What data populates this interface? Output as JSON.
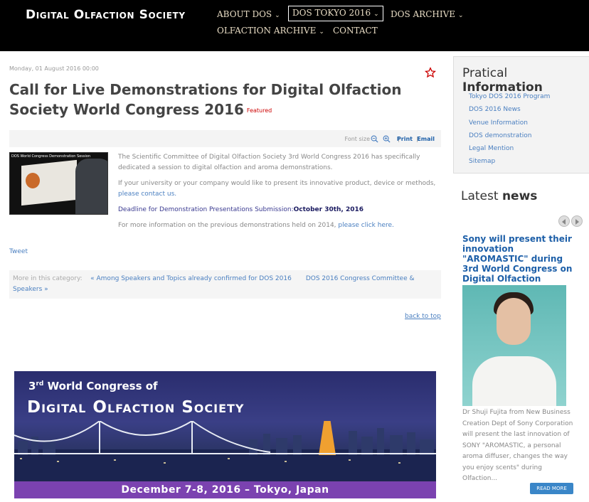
{
  "header": {
    "logo": "Digital Olfaction Society",
    "nav": [
      {
        "label": "ABOUT DOS",
        "has_dropdown": true
      },
      {
        "label": "DOS TOKYO 2016",
        "has_dropdown": true,
        "active": true
      },
      {
        "label": "DOS ARCHIVE",
        "has_dropdown": true
      },
      {
        "label": "OLFACTION ARCHIVE",
        "has_dropdown": true
      },
      {
        "label": "CONTACT",
        "has_dropdown": false
      }
    ]
  },
  "article": {
    "date": "Monday, 01 August 2016 00:00",
    "title": "Call for Live Demonstrations for Digital Olfaction Society World Congress 2016",
    "featured": "Featured",
    "toolbar": {
      "font_size": "Font size",
      "separator": "|",
      "print": "Print",
      "email": "Email"
    },
    "thumb_caption": "DOS World Congress Demonstration Session",
    "p1": "The Scientific Committee of Digital Olfaction Society 3rd World Congress 2016 has specifically dedicated a session to digital olfaction and aroma demonstrations.",
    "p2": "If your university or your company would like to present its innovative product, device or methods,",
    "p2_link": "please contact us.",
    "deadline_label": "Deadline for Demonstration Presentations Submission:",
    "deadline_date": "October 30th, 2016",
    "p4": "For more information on the previous demonstrations held on 2014,",
    "p4_link": "please click here.",
    "tweet": "Tweet",
    "more_label": "More in this category:",
    "prev_link": "« Among Speakers and Topics already confirmed for DOS 2016",
    "next_link": "DOS 2016 Congress Committee & Speakers »",
    "back_to_top": "back to top"
  },
  "banner": {
    "line1_ordinal": "3",
    "line1_sup": "rd",
    "line1_rest": "World Congress of",
    "line2": "Digital Olfaction Society",
    "bar": "December 7-8, 2016 – Tokyo, Japan"
  },
  "sidebar": {
    "pi_title_light": "Pratical",
    "pi_title_bold": "Information",
    "pi_links": [
      "Tokyo DOS 2016 Program",
      "DOS 2016 News",
      "Venue Information",
      "DOS demonstration",
      "Legal Mention",
      "Sitemap"
    ],
    "ln_title_light": "Latest",
    "ln_title_bold": "news",
    "news_headline": "Sony will present their innovation \"AROMASTIC\" during 3rd World Congress on Digital Olfaction",
    "news_text": "Dr Shuji Fujita from New Business Creation Dept of Sony Corporation will present the last innovation of SONY \"AROMASTIC, a personal aroma diffuser, changes the way you enjoy scents\" during Olfaction...",
    "read_more": "READ MORE"
  },
  "colors": {
    "accent_link": "#4a7fc0",
    "header_bg": "#000000",
    "featured": "#cc0000",
    "banner_bar": "#7b42b0"
  }
}
